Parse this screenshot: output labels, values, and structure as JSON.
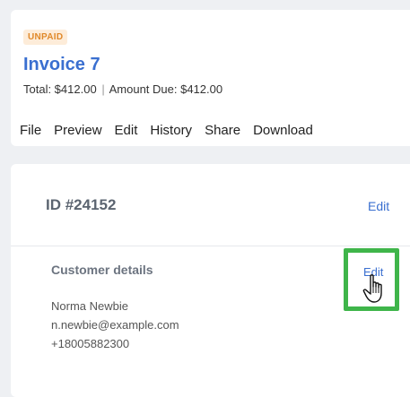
{
  "invoice": {
    "status_badge": "UNPAID",
    "title": "Invoice 7",
    "total_label": "Total: $412.00",
    "separator": "|",
    "amount_due_label": "Amount Due: $412.00"
  },
  "actions": [
    "File",
    "Preview",
    "Edit",
    "History",
    "Share",
    "Download"
  ],
  "details": {
    "id_label": "ID #24152",
    "edit_label": "Edit",
    "section_title": "Customer details",
    "section_edit_label": "Edit",
    "customer": {
      "name": "Norma Newbie",
      "email": "n.newbie@example.com",
      "phone": "+18005882300"
    }
  },
  "colors": {
    "accent": "#3a6fd0",
    "badge_bg": "#fdecd9",
    "badge_text": "#e0892a",
    "highlight": "#3fb54a"
  },
  "icons": {
    "cursor": "hand-pointer-icon"
  }
}
